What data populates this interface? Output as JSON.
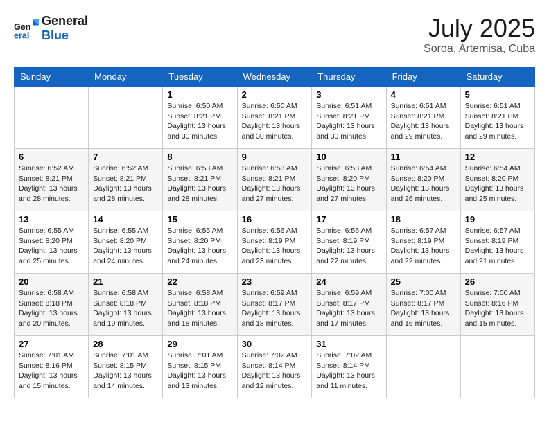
{
  "header": {
    "logo_general": "General",
    "logo_blue": "Blue",
    "month": "July 2025",
    "location": "Soroa, Artemisa, Cuba"
  },
  "days_of_week": [
    "Sunday",
    "Monday",
    "Tuesday",
    "Wednesday",
    "Thursday",
    "Friday",
    "Saturday"
  ],
  "weeks": [
    [
      {
        "day": "",
        "sunrise": "",
        "sunset": "",
        "daylight": ""
      },
      {
        "day": "",
        "sunrise": "",
        "sunset": "",
        "daylight": ""
      },
      {
        "day": "1",
        "sunrise": "Sunrise: 6:50 AM",
        "sunset": "Sunset: 8:21 PM",
        "daylight": "Daylight: 13 hours and 30 minutes."
      },
      {
        "day": "2",
        "sunrise": "Sunrise: 6:50 AM",
        "sunset": "Sunset: 8:21 PM",
        "daylight": "Daylight: 13 hours and 30 minutes."
      },
      {
        "day": "3",
        "sunrise": "Sunrise: 6:51 AM",
        "sunset": "Sunset: 8:21 PM",
        "daylight": "Daylight: 13 hours and 30 minutes."
      },
      {
        "day": "4",
        "sunrise": "Sunrise: 6:51 AM",
        "sunset": "Sunset: 8:21 PM",
        "daylight": "Daylight: 13 hours and 29 minutes."
      },
      {
        "day": "5",
        "sunrise": "Sunrise: 6:51 AM",
        "sunset": "Sunset: 8:21 PM",
        "daylight": "Daylight: 13 hours and 29 minutes."
      }
    ],
    [
      {
        "day": "6",
        "sunrise": "Sunrise: 6:52 AM",
        "sunset": "Sunset: 8:21 PM",
        "daylight": "Daylight: 13 hours and 28 minutes."
      },
      {
        "day": "7",
        "sunrise": "Sunrise: 6:52 AM",
        "sunset": "Sunset: 8:21 PM",
        "daylight": "Daylight: 13 hours and 28 minutes."
      },
      {
        "day": "8",
        "sunrise": "Sunrise: 6:53 AM",
        "sunset": "Sunset: 8:21 PM",
        "daylight": "Daylight: 13 hours and 28 minutes."
      },
      {
        "day": "9",
        "sunrise": "Sunrise: 6:53 AM",
        "sunset": "Sunset: 8:21 PM",
        "daylight": "Daylight: 13 hours and 27 minutes."
      },
      {
        "day": "10",
        "sunrise": "Sunrise: 6:53 AM",
        "sunset": "Sunset: 8:20 PM",
        "daylight": "Daylight: 13 hours and 27 minutes."
      },
      {
        "day": "11",
        "sunrise": "Sunrise: 6:54 AM",
        "sunset": "Sunset: 8:20 PM",
        "daylight": "Daylight: 13 hours and 26 minutes."
      },
      {
        "day": "12",
        "sunrise": "Sunrise: 6:54 AM",
        "sunset": "Sunset: 8:20 PM",
        "daylight": "Daylight: 13 hours and 25 minutes."
      }
    ],
    [
      {
        "day": "13",
        "sunrise": "Sunrise: 6:55 AM",
        "sunset": "Sunset: 8:20 PM",
        "daylight": "Daylight: 13 hours and 25 minutes."
      },
      {
        "day": "14",
        "sunrise": "Sunrise: 6:55 AM",
        "sunset": "Sunset: 8:20 PM",
        "daylight": "Daylight: 13 hours and 24 minutes."
      },
      {
        "day": "15",
        "sunrise": "Sunrise: 6:55 AM",
        "sunset": "Sunset: 8:20 PM",
        "daylight": "Daylight: 13 hours and 24 minutes."
      },
      {
        "day": "16",
        "sunrise": "Sunrise: 6:56 AM",
        "sunset": "Sunset: 8:19 PM",
        "daylight": "Daylight: 13 hours and 23 minutes."
      },
      {
        "day": "17",
        "sunrise": "Sunrise: 6:56 AM",
        "sunset": "Sunset: 8:19 PM",
        "daylight": "Daylight: 13 hours and 22 minutes."
      },
      {
        "day": "18",
        "sunrise": "Sunrise: 6:57 AM",
        "sunset": "Sunset: 8:19 PM",
        "daylight": "Daylight: 13 hours and 22 minutes."
      },
      {
        "day": "19",
        "sunrise": "Sunrise: 6:57 AM",
        "sunset": "Sunset: 8:19 PM",
        "daylight": "Daylight: 13 hours and 21 minutes."
      }
    ],
    [
      {
        "day": "20",
        "sunrise": "Sunrise: 6:58 AM",
        "sunset": "Sunset: 8:18 PM",
        "daylight": "Daylight: 13 hours and 20 minutes."
      },
      {
        "day": "21",
        "sunrise": "Sunrise: 6:58 AM",
        "sunset": "Sunset: 8:18 PM",
        "daylight": "Daylight: 13 hours and 19 minutes."
      },
      {
        "day": "22",
        "sunrise": "Sunrise: 6:58 AM",
        "sunset": "Sunset: 8:18 PM",
        "daylight": "Daylight: 13 hours and 18 minutes."
      },
      {
        "day": "23",
        "sunrise": "Sunrise: 6:59 AM",
        "sunset": "Sunset: 8:17 PM",
        "daylight": "Daylight: 13 hours and 18 minutes."
      },
      {
        "day": "24",
        "sunrise": "Sunrise: 6:59 AM",
        "sunset": "Sunset: 8:17 PM",
        "daylight": "Daylight: 13 hours and 17 minutes."
      },
      {
        "day": "25",
        "sunrise": "Sunrise: 7:00 AM",
        "sunset": "Sunset: 8:17 PM",
        "daylight": "Daylight: 13 hours and 16 minutes."
      },
      {
        "day": "26",
        "sunrise": "Sunrise: 7:00 AM",
        "sunset": "Sunset: 8:16 PM",
        "daylight": "Daylight: 13 hours and 15 minutes."
      }
    ],
    [
      {
        "day": "27",
        "sunrise": "Sunrise: 7:01 AM",
        "sunset": "Sunset: 8:16 PM",
        "daylight": "Daylight: 13 hours and 15 minutes."
      },
      {
        "day": "28",
        "sunrise": "Sunrise: 7:01 AM",
        "sunset": "Sunset: 8:15 PM",
        "daylight": "Daylight: 13 hours and 14 minutes."
      },
      {
        "day": "29",
        "sunrise": "Sunrise: 7:01 AM",
        "sunset": "Sunset: 8:15 PM",
        "daylight": "Daylight: 13 hours and 13 minutes."
      },
      {
        "day": "30",
        "sunrise": "Sunrise: 7:02 AM",
        "sunset": "Sunset: 8:14 PM",
        "daylight": "Daylight: 13 hours and 12 minutes."
      },
      {
        "day": "31",
        "sunrise": "Sunrise: 7:02 AM",
        "sunset": "Sunset: 8:14 PM",
        "daylight": "Daylight: 13 hours and 11 minutes."
      },
      {
        "day": "",
        "sunrise": "",
        "sunset": "",
        "daylight": ""
      },
      {
        "day": "",
        "sunrise": "",
        "sunset": "",
        "daylight": ""
      }
    ]
  ]
}
